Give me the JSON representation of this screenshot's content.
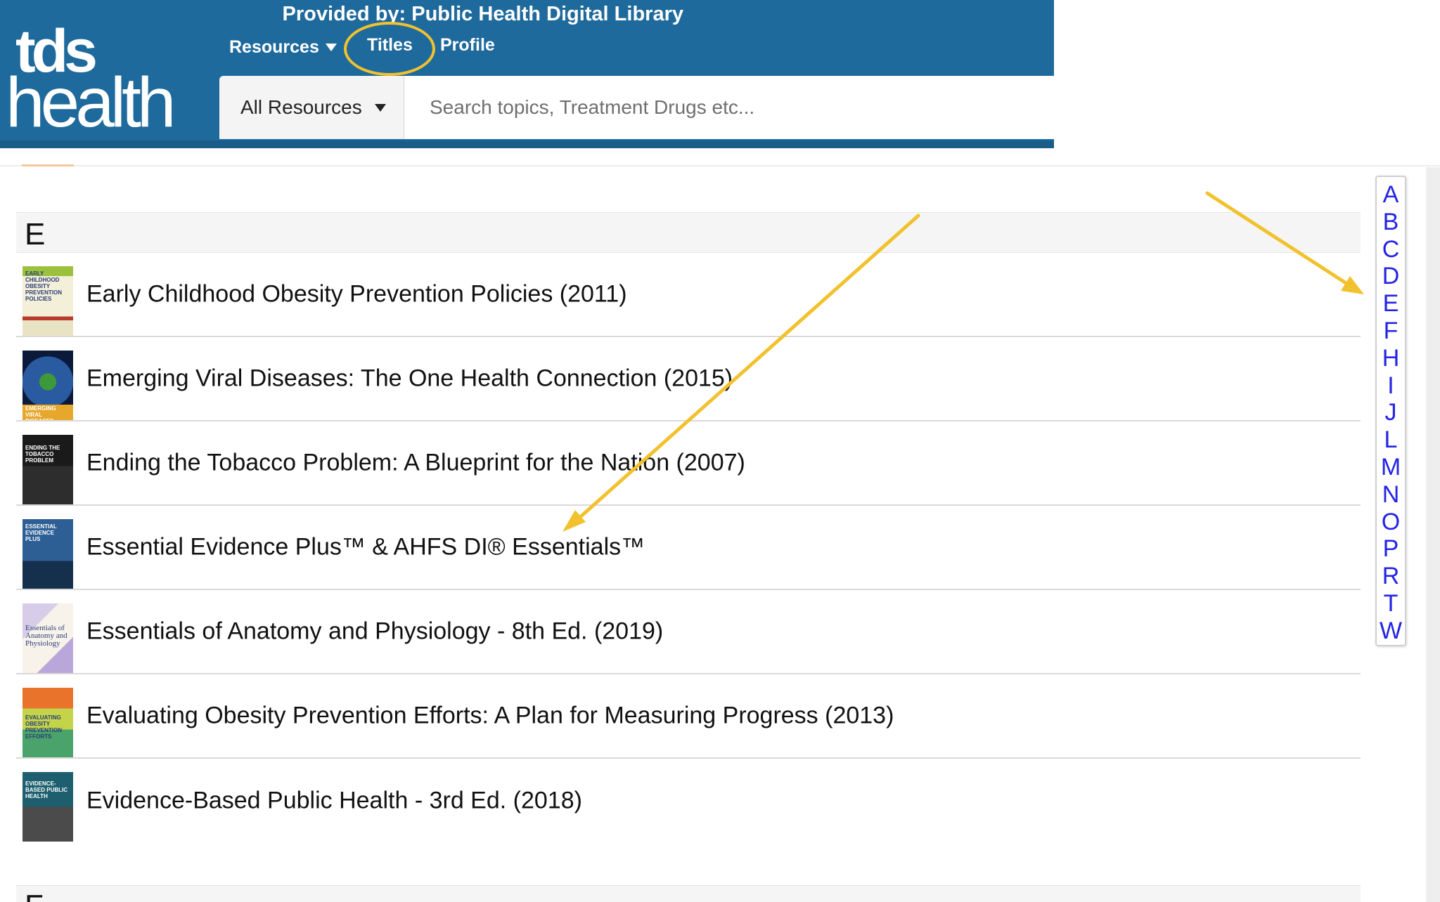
{
  "header": {
    "logo_line1": "tds",
    "logo_line2": "health",
    "provided_by": "Provided by: Public Health Digital Library",
    "nav": {
      "resources": "Resources",
      "titles": "Titles",
      "profile": "Profile"
    },
    "search": {
      "scope": "All Resources",
      "placeholder": "Search topics, Treatment Drugs etc..."
    }
  },
  "section": {
    "letter": "E",
    "next_letter": "F"
  },
  "titles": [
    {
      "title": "Early Childhood Obesity Prevention Policies (2011)",
      "cover_text": "EARLY CHILDHOOD OBESITY PREVENTION POLICIES"
    },
    {
      "title": "Emerging Viral Diseases: The One Health Connection (2015)",
      "cover_text": "EMERGING VIRAL DISEASES"
    },
    {
      "title": "Ending the Tobacco Problem: A Blueprint for the Nation (2007)",
      "cover_text": "ENDING THE TOBACCO PROBLEM"
    },
    {
      "title": "Essential Evidence Plus™ & AHFS DI® Essentials™",
      "cover_text": "ESSENTIAL EVIDENCE PLUS"
    },
    {
      "title": "Essentials of Anatomy and Physiology - 8th Ed. (2019)",
      "cover_text": "Essentials of Anatomy and Physiology"
    },
    {
      "title": "Evaluating Obesity Prevention Efforts: A Plan for Measuring Progress (2013)",
      "cover_text": "EVALUATING OBESITY PREVENTION EFFORTS"
    },
    {
      "title": "Evidence-Based Public Health - 3rd Ed. (2018)",
      "cover_text": "EVIDENCE-BASED PUBLIC HEALTH"
    }
  ],
  "alphabet": [
    "A",
    "B",
    "C",
    "D",
    "E",
    "F",
    "H",
    "I",
    "J",
    "L",
    "M",
    "N",
    "O",
    "P",
    "R",
    "T",
    "W"
  ],
  "colors": {
    "header_blue": "#1f6a9c",
    "highlight_yellow": "#f2c12e",
    "index_link_blue": "#2424e6"
  }
}
